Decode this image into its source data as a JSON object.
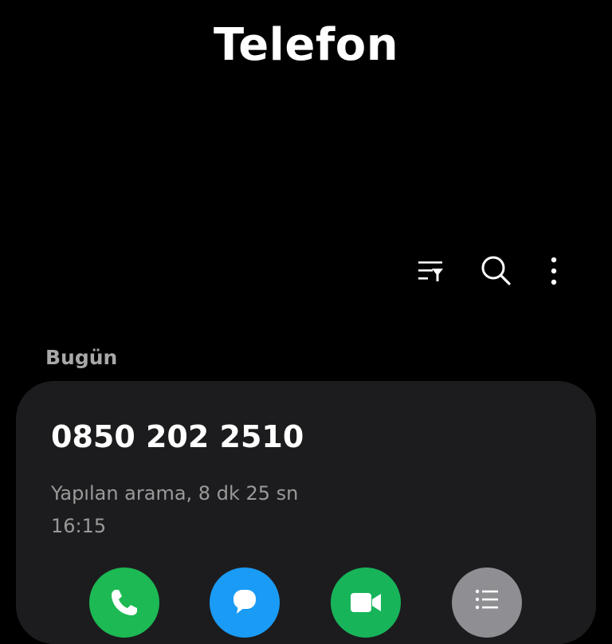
{
  "header": {
    "title": "Telefon"
  },
  "toolbar": {
    "icons": [
      "filter-icon",
      "search-icon",
      "more-options-icon"
    ]
  },
  "recents": {
    "section_label": "Bugün",
    "entry": {
      "number": "0850 202 2510",
      "detail": "Yapılan arama, 8 dk 25 sn",
      "time": "16:15"
    },
    "actions": [
      {
        "name": "call",
        "icon": "phone-icon",
        "color": "#1db954"
      },
      {
        "name": "message",
        "icon": "message-icon",
        "color": "#1a9bf5"
      },
      {
        "name": "video",
        "icon": "video-icon",
        "color": "#17b45a"
      },
      {
        "name": "details",
        "icon": "list-icon",
        "color": "#8e8e93"
      }
    ]
  }
}
